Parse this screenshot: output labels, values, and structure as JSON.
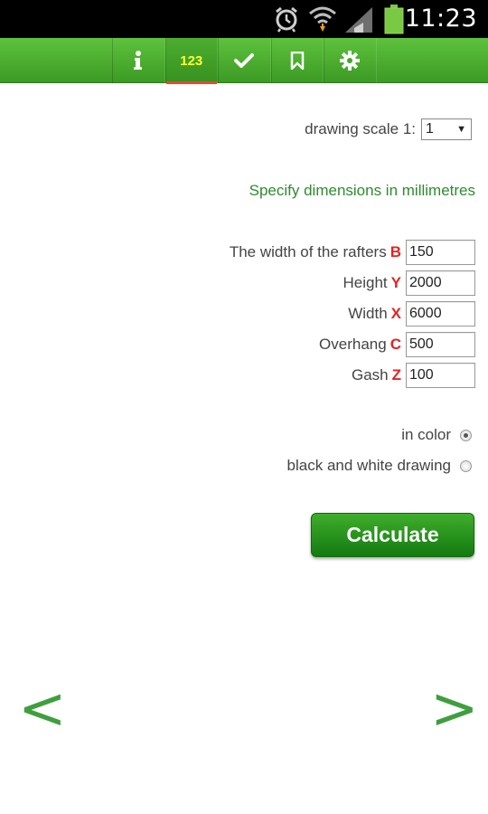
{
  "status_bar": {
    "time": "11:23",
    "icons": [
      "alarm-clock-icon",
      "wifi-icon",
      "signal-icon",
      "battery-icon"
    ]
  },
  "toolbar": {
    "tabs": [
      {
        "name": "info",
        "icon": "info-icon",
        "label": ""
      },
      {
        "name": "input",
        "icon": "numbers-icon",
        "label": "123",
        "active": true
      },
      {
        "name": "results",
        "icon": "checkmark-icon",
        "label": ""
      },
      {
        "name": "bookmark",
        "icon": "bookmark-icon",
        "label": ""
      },
      {
        "name": "settings",
        "icon": "gear-icon",
        "label": ""
      }
    ]
  },
  "form": {
    "scale_label": "drawing scale 1:",
    "scale_value": "1",
    "hint": "Specify dimensions in millimetres",
    "fields": [
      {
        "label": "The width of the rafters",
        "letter": "B",
        "value": "150"
      },
      {
        "label": "Height",
        "letter": "Y",
        "value": "2000"
      },
      {
        "label": "Width",
        "letter": "X",
        "value": "6000"
      },
      {
        "label": "Overhang",
        "letter": "C",
        "value": "500"
      },
      {
        "label": "Gash",
        "letter": "Z",
        "value": "100"
      }
    ],
    "options": [
      {
        "label": "in color",
        "checked": true
      },
      {
        "label": "black and white drawing",
        "checked": false
      }
    ],
    "calculate_label": "Calculate"
  },
  "navigation": {
    "prev": "<",
    "next": ">"
  },
  "colors": {
    "toolbar_green": "#4caf2f",
    "accent_green": "#2e8b2e",
    "letter_red": "#e52222",
    "active_tab_underline": "#e64a2e"
  }
}
